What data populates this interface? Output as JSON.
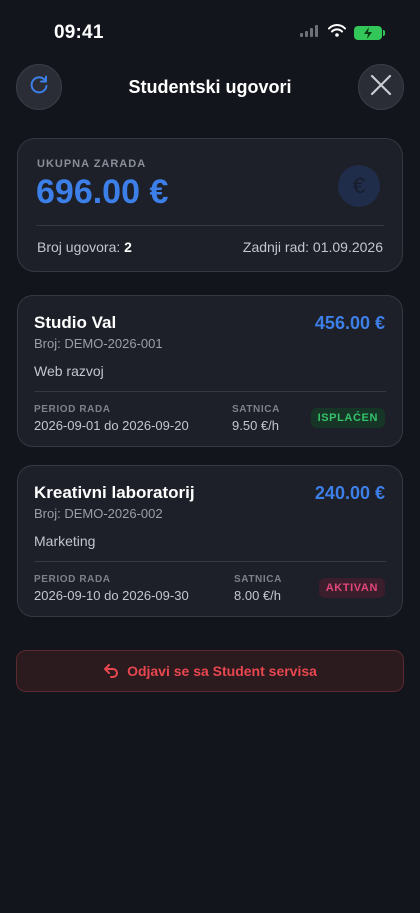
{
  "status_bar": {
    "time": "09:41"
  },
  "header": {
    "title": "Studentski ugovori"
  },
  "summary": {
    "label": "UKUPNA ZARADA",
    "total": "696.00 €",
    "count_label": "Broj ugovora:",
    "count_value": "2",
    "last_work": "Zadnji rad: 01.09.2026",
    "euro_symbol": "€"
  },
  "contracts": [
    {
      "name": "Studio Val",
      "amount": "456.00 €",
      "number": "Broj: DEMO-2026-001",
      "type": "Web razvoj",
      "period_label": "PERIOD RADA",
      "period": "2026-09-01 do 2026-09-20",
      "rate_label": "SATNICA",
      "rate": "9.50 €/h",
      "status": "ISPLAĆEN"
    },
    {
      "name": "Kreativni laboratorij",
      "amount": "240.00 €",
      "number": "Broj: DEMO-2026-002",
      "type": "Marketing",
      "period_label": "PERIOD RADA",
      "period": "2026-09-10 do 2026-09-30",
      "rate_label": "SATNICA",
      "rate": "8.00 €/h",
      "status": "AKTIVAN"
    }
  ],
  "logout": {
    "label": "Odjavi se sa Student servisa"
  },
  "colors": {
    "accent": "#3d7fe8",
    "paid": "#34c26a",
    "active": "#e2467a",
    "danger": "#e8474f"
  }
}
